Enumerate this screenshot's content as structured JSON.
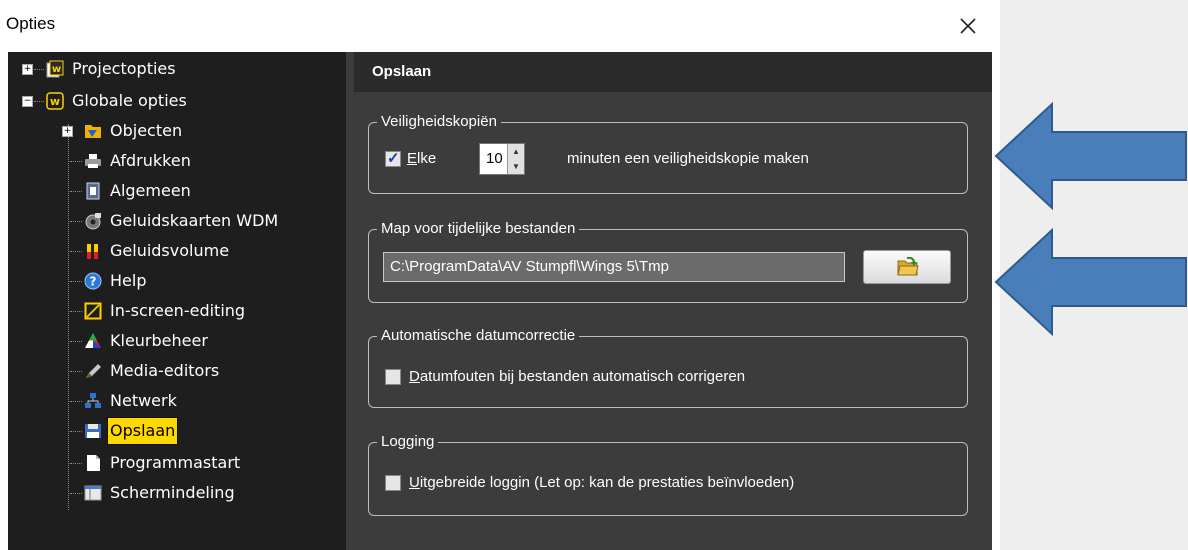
{
  "window": {
    "title": "Opties"
  },
  "tree": {
    "items": [
      {
        "label": "Projectopties"
      },
      {
        "label": "Globale opties"
      },
      {
        "label": "Objecten"
      },
      {
        "label": "Afdrukken"
      },
      {
        "label": "Algemeen"
      },
      {
        "label": "Geluidskaarten WDM"
      },
      {
        "label": "Geluidsvolume"
      },
      {
        "label": "Help"
      },
      {
        "label": "In-screen-editing"
      },
      {
        "label": "Kleurbeheer"
      },
      {
        "label": "Media-editors"
      },
      {
        "label": "Netwerk"
      },
      {
        "label": "Opslaan"
      },
      {
        "label": "Programmastart"
      },
      {
        "label": "Schermindeling"
      }
    ],
    "selected": "Opslaan"
  },
  "panel": {
    "header": "Opslaan",
    "backup": {
      "legend": "Veiligheidskopiën",
      "checkbox_checked": true,
      "checkbox_label_u": "E",
      "checkbox_label_rest": "lke",
      "minutes_value": "10",
      "suffix": "minuten een veiligheidskopie maken"
    },
    "temp": {
      "legend": "Map voor tijdelijke bestanden",
      "path": "C:\\ProgramData\\AV Stumpfl\\Wings 5\\Tmp"
    },
    "datefix": {
      "legend": "Automatische datumcorrectie",
      "checkbox_checked": false,
      "label_u": "D",
      "label_rest": "atumfouten bij bestanden automatisch corrigeren"
    },
    "logging": {
      "legend": "Logging",
      "checkbox_checked": false,
      "label_u": "U",
      "label_rest": "itgebreide loggin (Let op: kan de prestaties beïnvloeden)"
    }
  },
  "colors": {
    "selection": "#ffd800",
    "arrow_fill": "#4a7ebb",
    "arrow_stroke": "#2f5a8c"
  }
}
